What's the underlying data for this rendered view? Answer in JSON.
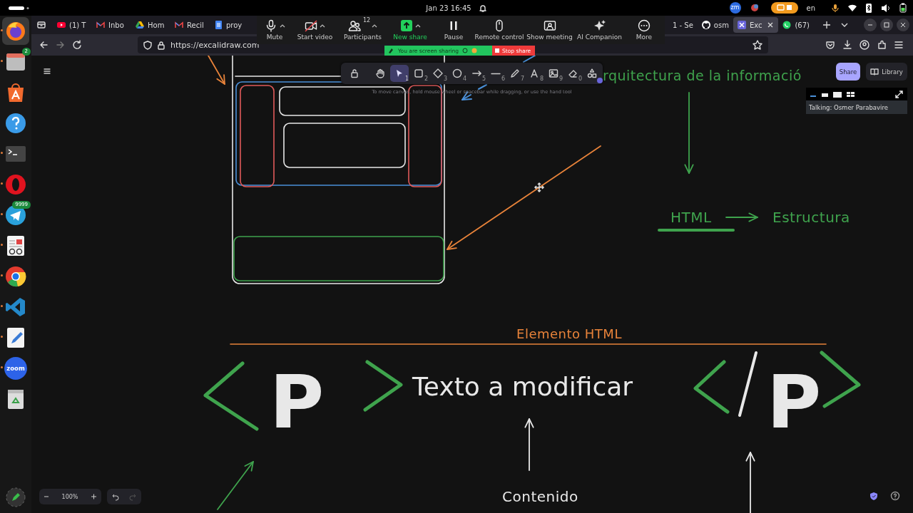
{
  "top_bar": {
    "clock": "Jan 23  16:45",
    "tray_label": "zm",
    "language": "en"
  },
  "dock": [
    {
      "kind": "firefox",
      "selected": true,
      "running": true
    },
    {
      "kind": "files",
      "selected": false,
      "running": true,
      "badge": "2"
    },
    {
      "kind": "store",
      "selected": false,
      "running": false
    },
    {
      "kind": "help",
      "selected": false,
      "running": false
    },
    {
      "kind": "terminal",
      "selected": false,
      "running": true
    },
    {
      "kind": "opera",
      "selected": false,
      "running": true
    },
    {
      "kind": "telegram",
      "selected": false,
      "running": true,
      "badge": "9999"
    },
    {
      "kind": "reader",
      "selected": false,
      "running": true
    },
    {
      "kind": "chrome",
      "selected": false,
      "running": true
    },
    {
      "kind": "vscode",
      "selected": false,
      "running": true
    },
    {
      "kind": "editor",
      "selected": false,
      "running": true
    },
    {
      "kind": "zoom",
      "selected": false,
      "running": true,
      "text": "zoom"
    },
    {
      "kind": "trash",
      "selected": false,
      "running": false
    }
  ],
  "tabs": [
    {
      "kind": "youtube",
      "label": "(1) T",
      "selected": false
    },
    {
      "kind": "gmail",
      "label": "Inbo",
      "selected": false
    },
    {
      "kind": "drive",
      "label": "Hom",
      "selected": false
    },
    {
      "kind": "gmail",
      "label": "Recil",
      "selected": false
    },
    {
      "kind": "docs",
      "label": "proy",
      "selected": false
    },
    {
      "kind": "plain",
      "label": "1 - Se",
      "selected": false
    },
    {
      "kind": "github",
      "label": "osm",
      "selected": false
    },
    {
      "kind": "excalidraw",
      "label": "Exc",
      "selected": true
    },
    {
      "kind": "whatsapp",
      "label": "(67)",
      "selected": false
    }
  ],
  "address": "https://excalidraw.com",
  "meeting": {
    "items": [
      {
        "kind": "mic",
        "label": "Mute",
        "menu": true
      },
      {
        "kind": "video_off",
        "label": "Start video",
        "menu": true
      },
      {
        "kind": "participants",
        "label": "Participants",
        "count": "12",
        "menu": true
      },
      {
        "kind": "share",
        "label": "New share",
        "menu": true
      },
      {
        "kind": "pause",
        "label": "Pause",
        "menu": false
      },
      {
        "kind": "mouse",
        "label": "Remote control",
        "menu": false
      },
      {
        "kind": "meeting",
        "label": "Show meeting",
        "menu": false
      },
      {
        "kind": "sparkle",
        "label": "AI Companion",
        "menu": false
      },
      {
        "kind": "more",
        "label": "More",
        "menu": false
      }
    ],
    "sharing_status": "You are screen sharing",
    "stop_button": "Stop share"
  },
  "toolbar": {
    "tools": [
      {
        "kind": "lock",
        "selected": false
      },
      {
        "kind": "hand",
        "selected": false
      },
      {
        "kind": "select",
        "key": "1",
        "selected": true
      },
      {
        "kind": "rectangle",
        "key": "2",
        "selected": false
      },
      {
        "kind": "diamond",
        "key": "3",
        "selected": false
      },
      {
        "kind": "ellipse",
        "key": "4",
        "selected": false
      },
      {
        "kind": "arrow",
        "key": "5",
        "selected": false
      },
      {
        "kind": "line",
        "key": "6",
        "selected": false
      },
      {
        "kind": "pencil",
        "key": "7",
        "selected": false
      },
      {
        "kind": "text",
        "key": "8",
        "selected": false
      },
      {
        "kind": "image",
        "key": "9",
        "selected": false
      },
      {
        "kind": "eraser",
        "key": "0",
        "selected": false
      },
      {
        "kind": "extra",
        "selected": false
      }
    ],
    "hint": "To move canvas, hold mouse wheel or spacebar while dragging, or use the hand tool"
  },
  "share_button": "Share",
  "library_button": "Library",
  "video_panel": {
    "talking": "Talking: Osmer Parabavire"
  },
  "canvas": {
    "labels": [
      {
        "kind": "heading",
        "text": "rquitectura de la informació"
      },
      {
        "kind": "term",
        "text": "HTML"
      },
      {
        "kind": "term",
        "text": "Estructura"
      },
      {
        "kind": "section",
        "text": "Elemento HTML"
      },
      {
        "kind": "tag_letter",
        "text": "P"
      },
      {
        "kind": "content",
        "text": "Texto a modificar"
      },
      {
        "kind": "tag_letter",
        "text": "P"
      },
      {
        "kind": "caption",
        "text": "Contenido"
      }
    ]
  },
  "zoom_level": "100%"
}
